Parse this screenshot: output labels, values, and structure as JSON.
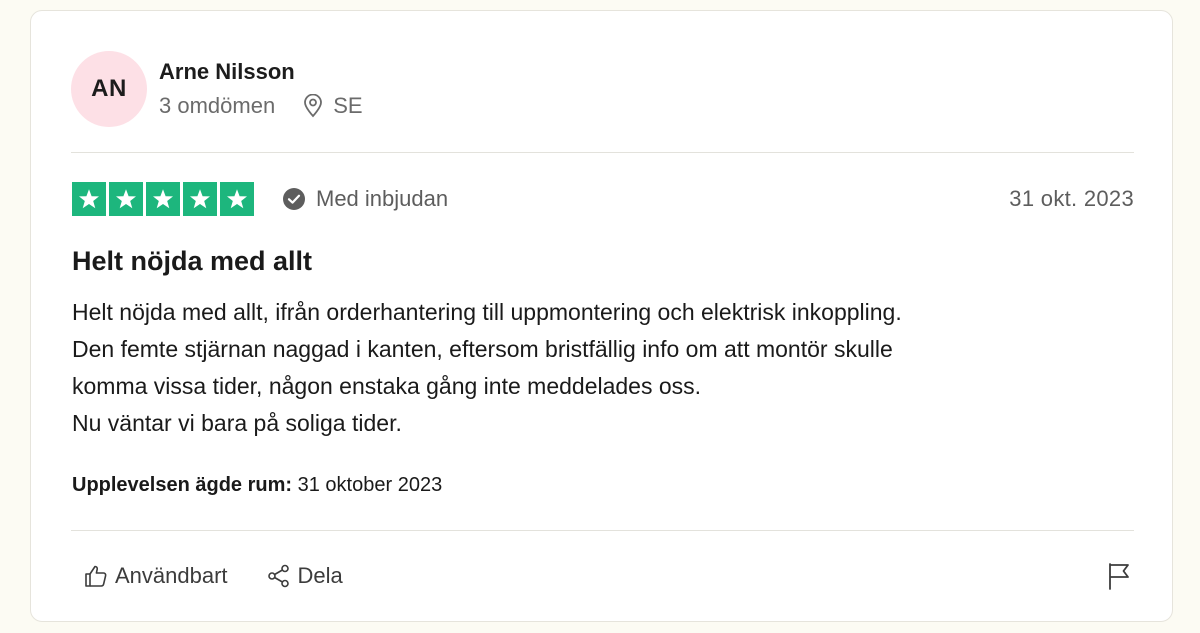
{
  "reviewer": {
    "initials": "AN",
    "name": "Arne Nilsson",
    "reviews_count": "3 omdömen",
    "country": "SE",
    "avatar_color": "#fde0e6"
  },
  "rating": {
    "stars": 5,
    "max_stars": 5,
    "star_color": "#1db67d",
    "verified_label": "Med inbjudan",
    "date": "31 okt. 2023"
  },
  "review": {
    "title": "Helt nöjda med allt",
    "body_lines": [
      "Helt nöjda med allt, ifrån orderhantering till uppmontering och elektrisk inkoppling.",
      "Den femte stjärnan naggad i kanten, eftersom bristfällig info om att montör skulle",
      "komma vissa tider, någon enstaka gång inte meddelades oss.",
      "Nu väntar vi bara på soliga tider."
    ],
    "experience_label": "Upplevelsen ägde rum:",
    "experience_date": "31 oktober 2023"
  },
  "actions": {
    "useful_label": "Användbart",
    "share_label": "Dela",
    "useful_icon": "thumbs-up-icon",
    "share_icon": "share-icon",
    "flag_icon": "flag-icon"
  }
}
